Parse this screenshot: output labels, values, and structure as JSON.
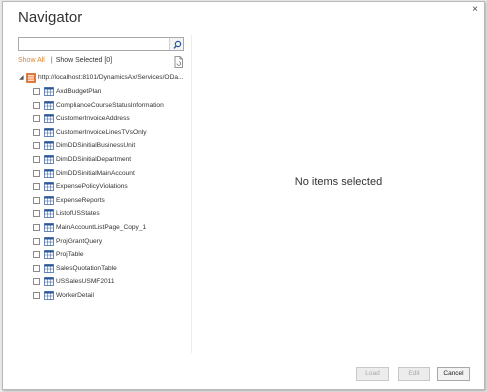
{
  "window": {
    "title": "Navigator",
    "close_glyph": "×"
  },
  "search": {
    "value": "",
    "placeholder": "",
    "icon": "search-icon"
  },
  "filter_links": {
    "show_all": "Show All",
    "separator": "|",
    "show_selected": "Show Selected [0]"
  },
  "tree": {
    "root": {
      "label": "http://localhost:8101/DynamicsAx/Services/ODa...",
      "icon": "odata-feed-icon",
      "expanded": true
    },
    "items": [
      {
        "label": "AxdBudgetPlan",
        "checked": false
      },
      {
        "label": "ComplianceCourseStatusInformation",
        "checked": false
      },
      {
        "label": "CustomerInvoiceAddress",
        "checked": false
      },
      {
        "label": "CustomerInvoiceLinesTVsOnly",
        "checked": false
      },
      {
        "label": "DimDDSinitialBusinessUnit",
        "checked": false
      },
      {
        "label": "DimDDSinitialDepartment",
        "checked": false
      },
      {
        "label": "DimDDSinitialMainAccount",
        "checked": false
      },
      {
        "label": "ExpensePolicyViolations",
        "checked": false
      },
      {
        "label": "ExpenseReports",
        "checked": false
      },
      {
        "label": "ListofUSStates",
        "checked": false
      },
      {
        "label": "MainAccountListPage_Copy_1",
        "checked": false
      },
      {
        "label": "ProjGrantQuery",
        "checked": false
      },
      {
        "label": "ProjTable",
        "checked": false
      },
      {
        "label": "SalesQuotationTable",
        "checked": false
      },
      {
        "label": "USSalesUSMF2011",
        "checked": false
      },
      {
        "label": "WorkerDetail",
        "checked": false
      }
    ]
  },
  "preview": {
    "empty_message": "No items selected"
  },
  "footer": {
    "load_label": "Load",
    "edit_label": "Edit",
    "cancel_label": "Cancel"
  },
  "colors": {
    "accent_link": "#d8842d",
    "table_icon_header": "#2b579a",
    "root_icon": "#e8702a"
  }
}
